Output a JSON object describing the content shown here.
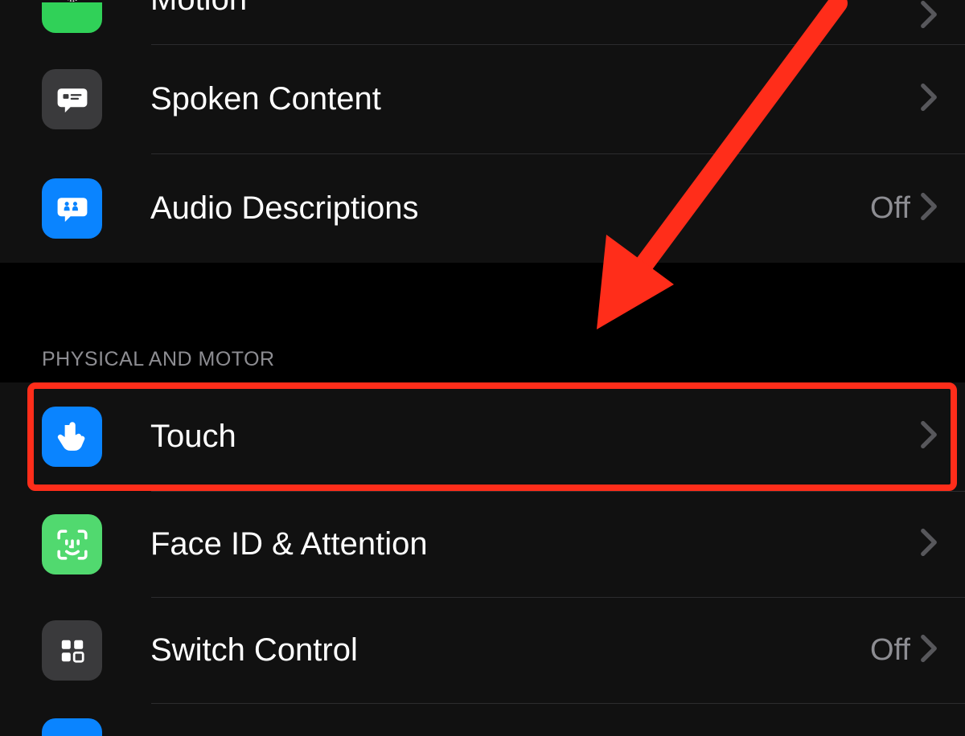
{
  "group1": {
    "items": [
      {
        "label": "Motion",
        "value": "",
        "icon": "motion-icon",
        "icon_bg": "green"
      },
      {
        "label": "Spoken Content",
        "value": "",
        "icon": "spoken-content-icon",
        "icon_bg": "gray"
      },
      {
        "label": "Audio Descriptions",
        "value": "Off",
        "icon": "audio-descriptions-icon",
        "icon_bg": "blue"
      }
    ]
  },
  "group2": {
    "header": "PHYSICAL AND MOTOR",
    "items": [
      {
        "label": "Touch",
        "value": "",
        "icon": "touch-icon",
        "icon_bg": "blue"
      },
      {
        "label": "Face ID & Attention",
        "value": "",
        "icon": "face-id-icon",
        "icon_bg": "lightgreen"
      },
      {
        "label": "Switch Control",
        "value": "Off",
        "icon": "switch-control-icon",
        "icon_bg": "gray"
      }
    ]
  },
  "highlighted_item": "Touch",
  "annotation": {
    "type": "arrow",
    "points_to": "Touch"
  }
}
